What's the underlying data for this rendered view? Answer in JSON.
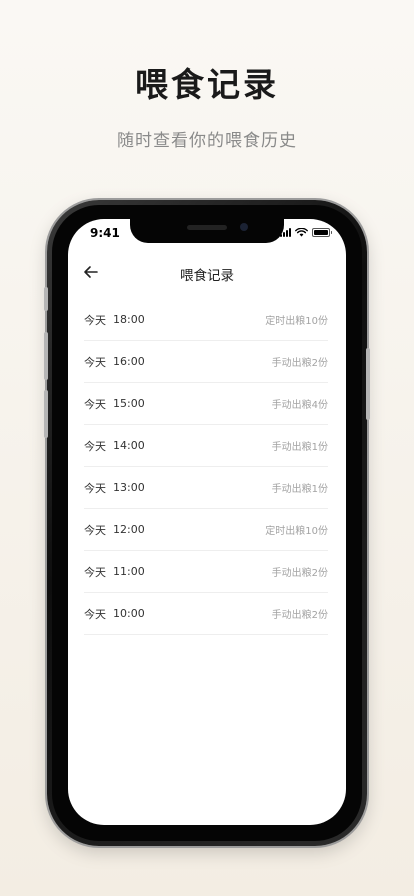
{
  "promo": {
    "title": "喂食记录",
    "subtitle": "随时查看你的喂食历史"
  },
  "status_bar": {
    "time": "9:41",
    "icons": [
      "signal-icon",
      "wifi-icon",
      "battery-icon"
    ]
  },
  "nav": {
    "back_icon": "arrow-left-icon",
    "title": "喂食记录"
  },
  "records": [
    {
      "day": "今天",
      "time": "18:00",
      "action": "定时出粮10份"
    },
    {
      "day": "今天",
      "time": "16:00",
      "action": "手动出粮2份"
    },
    {
      "day": "今天",
      "time": "15:00",
      "action": "手动出粮4份"
    },
    {
      "day": "今天",
      "time": "14:00",
      "action": "手动出粮1份"
    },
    {
      "day": "今天",
      "time": "13:00",
      "action": "手动出粮1份"
    },
    {
      "day": "今天",
      "time": "12:00",
      "action": "定时出粮10份"
    },
    {
      "day": "今天",
      "time": "11:00",
      "action": "手动出粮2份"
    },
    {
      "day": "今天",
      "time": "10:00",
      "action": "手动出粮2份"
    }
  ],
  "colors": {
    "background_top": "#faf8f4",
    "background_bottom": "#f3ede3",
    "title": "#1a1a1a",
    "subtitle": "#8a8a8a",
    "action_text": "#a3a3a3"
  }
}
